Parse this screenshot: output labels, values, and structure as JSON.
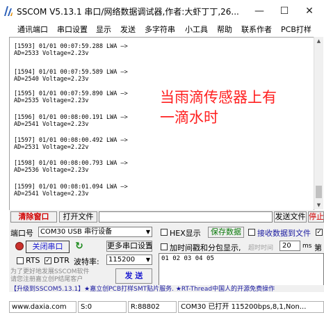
{
  "window": {
    "title": "SSCOM V5.13.1 串口/网络数据调试器,作者:大虾丁丁,26...",
    "min_glyph": "—",
    "max_glyph": "☐",
    "close_glyph": "✕"
  },
  "menu": [
    "通讯端口",
    "串口设置",
    "显示",
    "发送",
    "多字符串",
    "小工具",
    "帮助",
    "联系作者",
    "PCB打样"
  ],
  "log": [
    {
      "line1": "[1593] 01/01 00:07:59.288 LWA —>",
      "line2": "AD=2533 Voltage=2.23v"
    },
    {
      "line1": "[1594] 01/01 00:07:59.589 LWA —>",
      "line2": "AD=2540 Voltage=2.23v"
    },
    {
      "line1": "[1595] 01/01 00:07:59.890 LWA —>",
      "line2": "AD=2535 Voltage=2.23v"
    },
    {
      "line1": "[1596] 01/01 00:08:00.191 LWA —>",
      "line2": "AD=2541 Voltage=2.23v"
    },
    {
      "line1": "[1597] 01/01 00:08:00.492 LWA —>",
      "line2": "AD=2531 Voltage=2.22v"
    },
    {
      "line1": "[1598] 01/01 00:08:00.793 LWA —>",
      "line2": "AD=2536 Voltage=2.23v"
    },
    {
      "line1": "[1599] 01/01 00:08:01.094 LWA —>",
      "line2": "AD=2541 Voltage=2.23v"
    }
  ],
  "annotation": {
    "line1": "当雨滴传感器上有",
    "line2": "一滴水时",
    "color": "#ff1f1f"
  },
  "panel": {
    "clear_window": "清除窗口",
    "open_file": "打开文件",
    "send_file": "发送文件",
    "stop": "停止",
    "port_label": "端口号",
    "port_value": "COM30 USB 串行设备",
    "hex_display": "HEX显示",
    "save_data": "保存数据",
    "recv_to_file": "接收数据到文件",
    "more_settings": "更多串口设置",
    "timestamp_label": "加时间戳和分包显示,",
    "timeout_label": "超时时间",
    "timeout_value": "20",
    "timeout_unit": "ms",
    "nth_label": "第",
    "close_port": "关闭串口",
    "rts": "RTS",
    "dtr": "DTR",
    "baud_label": "波特率:",
    "baud_value": "115200",
    "send_text": "01 02 03 04 05",
    "promo1": "为了更好地发展SSCOM软件",
    "promo2": "请您注册嘉立创P结尾客户",
    "send_button": "发 送",
    "refresh_glyph": "↻",
    "banner": "【升级到SSCOM5.13.1】★嘉立创PCB打样SMT贴片服务. ★RT-Thread中国人的开源免费操作"
  },
  "status": {
    "website": "www.daxia.com",
    "sent": "S:0",
    "received": "R:88802",
    "port_state": "COM30 已打开  115200bps,8,1,Non..."
  }
}
